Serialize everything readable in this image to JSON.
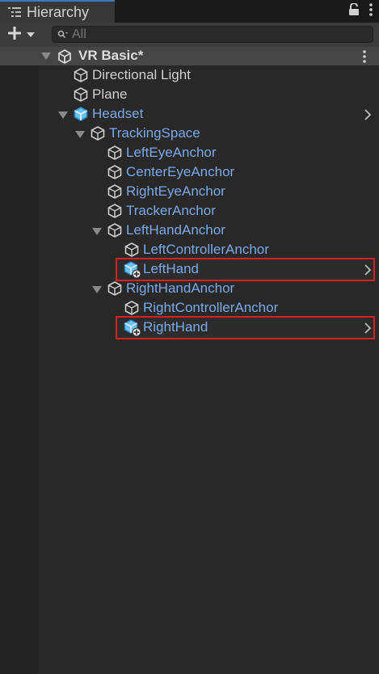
{
  "panel": {
    "title": "Hierarchy",
    "lock_icon": "lock-icon",
    "menu_icon": "kebab-menu-icon"
  },
  "toolbar": {
    "add_icon": "plus-icon",
    "search_placeholder": "All",
    "search_value": ""
  },
  "scene": {
    "name": "VR Basic*",
    "icon": "unity-logo-icon",
    "menu_icon": "kebab-menu-icon"
  },
  "tree": [
    {
      "label": "Directional Light",
      "style": "white",
      "icon": "gameobject-cube-icon"
    },
    {
      "label": "Plane",
      "style": "white",
      "icon": "gameobject-cube-icon"
    },
    {
      "label": "Headset",
      "style": "blue",
      "icon": "prefab-cube-icon",
      "expanded": true,
      "has_chevron": true
    },
    {
      "label": "TrackingSpace",
      "style": "blue",
      "icon": "gameobject-cube-icon",
      "expanded": true
    },
    {
      "label": "LeftEyeAnchor",
      "style": "blue",
      "icon": "gameobject-cube-icon"
    },
    {
      "label": "CenterEyeAnchor",
      "style": "blue",
      "icon": "gameobject-cube-icon"
    },
    {
      "label": "RightEyeAnchor",
      "style": "blue",
      "icon": "gameobject-cube-icon"
    },
    {
      "label": "TrackerAnchor",
      "style": "blue",
      "icon": "gameobject-cube-icon"
    },
    {
      "label": "LeftHandAnchor",
      "style": "blue",
      "icon": "gameobject-cube-icon",
      "expanded": true
    },
    {
      "label": "LeftControllerAnchor",
      "style": "blue",
      "icon": "gameobject-cube-icon"
    },
    {
      "label": "LeftHand",
      "style": "blue",
      "icon": "added-prefab-icon",
      "has_chevron": true,
      "highlighted": true
    },
    {
      "label": "RightHandAnchor",
      "style": "blue",
      "icon": "gameobject-cube-icon",
      "expanded": true
    },
    {
      "label": "RightControllerAnchor",
      "style": "blue",
      "icon": "gameobject-cube-icon"
    },
    {
      "label": "RightHand",
      "style": "blue",
      "icon": "added-prefab-icon",
      "has_chevron": true,
      "highlighted": true
    }
  ],
  "colors": {
    "highlight_border": "#d8201f",
    "prefab_text": "#7ba9e8",
    "prefab_icon": "#6cc3f0"
  }
}
